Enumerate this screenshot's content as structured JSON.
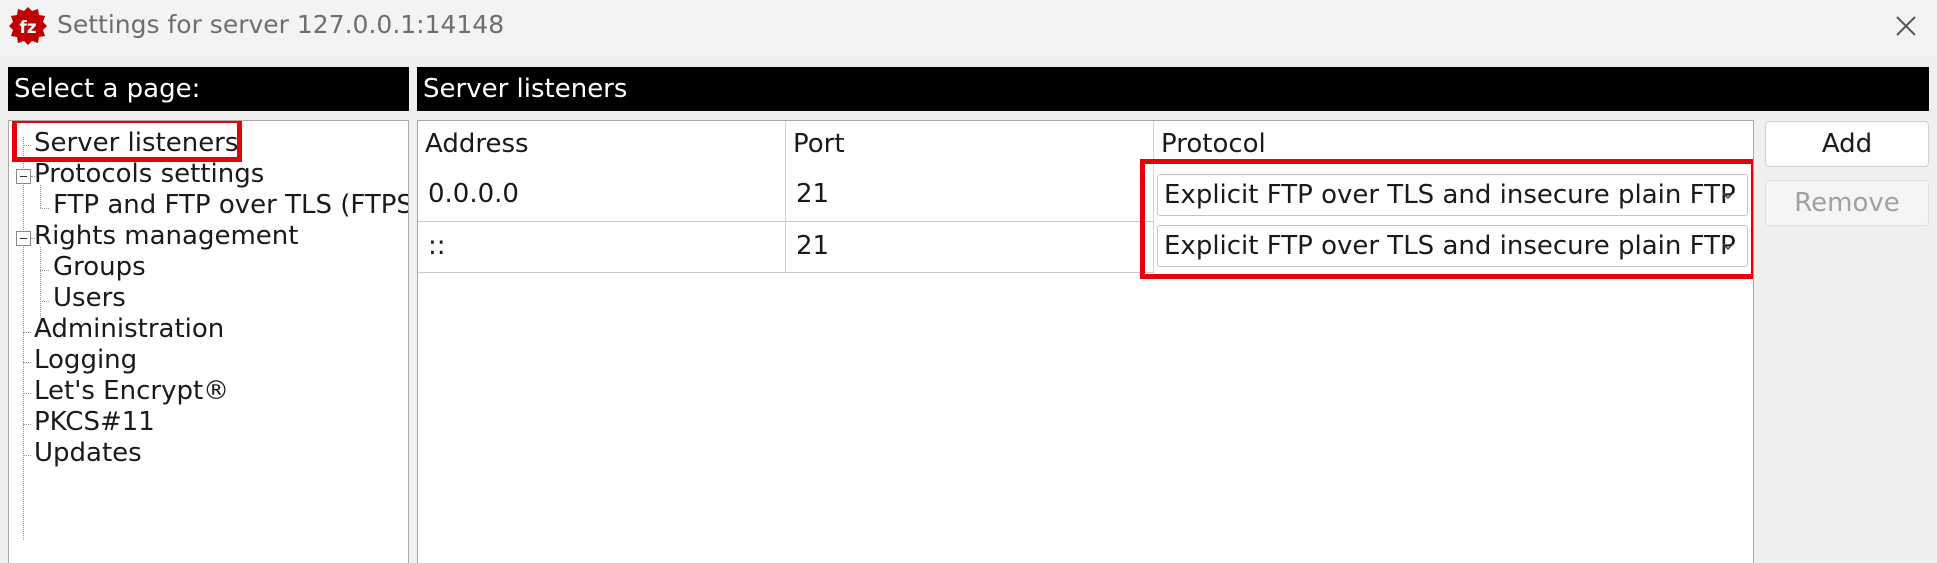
{
  "window": {
    "title": "Settings for server 127.0.0.1:14148",
    "app_icon": "filezilla-server-icon",
    "close_icon": "close-icon"
  },
  "colors": {
    "header_bg": "#000000",
    "header_fg": "#ffffff",
    "highlight": "#e8000b",
    "app_icon_red": "#bf0000"
  },
  "left_panel": {
    "header": "Select a page:",
    "tree": {
      "server_listeners": "Server listeners",
      "protocols_settings": "Protocols settings",
      "ftp_ftps": "FTP and FTP over TLS (FTPS)",
      "rights_management": "Rights management",
      "groups": "Groups",
      "users": "Users",
      "administration": "Administration",
      "logging": "Logging",
      "lets_encrypt": "Let's Encrypt®",
      "pkcs11": "PKCS#11",
      "updates": "Updates"
    },
    "selected": "Server listeners"
  },
  "right_panel": {
    "header": "Server listeners",
    "columns": {
      "address": "Address",
      "port": "Port",
      "protocol": "Protocol"
    },
    "rows": [
      {
        "address": "0.0.0.0",
        "port": "21",
        "protocol": "Explicit FTP over TLS and insecure plain FTP"
      },
      {
        "address": "::",
        "port": "21",
        "protocol": "Explicit FTP over TLS and insecure plain FTP"
      }
    ],
    "buttons": {
      "add": "Add",
      "remove": "Remove"
    }
  }
}
